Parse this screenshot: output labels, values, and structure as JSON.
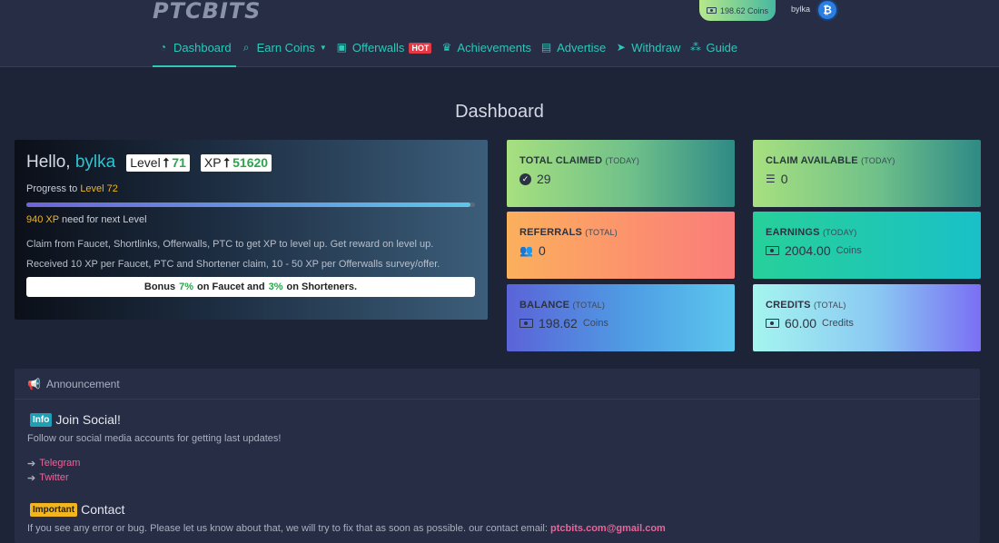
{
  "header": {
    "logo": "PTCBITS",
    "balance_pill": "198.62 Coins",
    "username": "bylka",
    "avatar_icon": "bitcoin-icon"
  },
  "nav": [
    {
      "label": "Dashboard",
      "icon": "dashboard-icon",
      "active": true
    },
    {
      "label": "Earn Coins",
      "icon": "search-dollar-icon",
      "dropdown": true
    },
    {
      "label": "Offerwalls",
      "icon": "gift-icon",
      "badge": "HOT"
    },
    {
      "label": "Achievements",
      "icon": "trophy-icon"
    },
    {
      "label": "Advertise",
      "icon": "ad-icon"
    },
    {
      "label": "Withdraw",
      "icon": "paper-plane-icon"
    },
    {
      "label": "Guide",
      "icon": "sitemap-icon"
    }
  ],
  "page_title": "Dashboard",
  "hello": {
    "greeting": "Hello,",
    "username": "bylka",
    "level_label": "Level",
    "level_value": "71",
    "xp_label": "XP",
    "xp_value": "51620",
    "progress_prefix": "Progress to",
    "progress_target": "Level 72",
    "progress_fraction": 0.99,
    "xp_needed": "940 XP",
    "xp_needed_suffix": "need for next Level",
    "desc1": "Claim from Faucet, Shortlinks, Offerwalls, PTC to get XP to level up. Get reward on level up.",
    "desc2": "Received 10 XP per Faucet, PTC and Shortener claim, 10 - 50 XP per Offerwalls survey/offer.",
    "bonus_prefix": "Bonus",
    "bonus_faucet_pct": "7%",
    "bonus_mid": "on Faucet and",
    "bonus_short_pct": "3%",
    "bonus_suffix": "on Shorteners."
  },
  "stats": {
    "total_claimed": {
      "title": "TOTAL CLAIMED",
      "sub": "(TODAY)",
      "value": "29",
      "icon": "check-circle-icon"
    },
    "claim_available": {
      "title": "CLAIM AVAILABLE",
      "sub": "(TODAY)",
      "value": "0",
      "icon": "tasks-icon"
    },
    "referrals": {
      "title": "REFERRALS",
      "sub": "(TOTAL)",
      "value": "0",
      "icon": "users-icon"
    },
    "earnings": {
      "title": "EARNINGS",
      "sub": "(TODAY)",
      "value": "2004.00",
      "unit": "Coins",
      "icon": "money-bill-icon"
    },
    "balance": {
      "title": "BALANCE",
      "sub": "(TOTAL)",
      "value": "198.62",
      "unit": "Coins",
      "icon": "money-bill-icon"
    },
    "credits": {
      "title": "CREDITS",
      "sub": "(TOTAL)",
      "value": "60.00",
      "unit": "Credits",
      "icon": "money-bill-icon"
    }
  },
  "announcement": {
    "header": "Announcement",
    "social_badge": "Info",
    "social_title": "Join Social!",
    "social_text": "Follow our social media accounts for getting last updates!",
    "links": [
      "Telegram",
      "Twitter"
    ],
    "contact_badge": "Important",
    "contact_title": "Contact",
    "contact_text": "If you see any error or bug. Please let us know about that, we will try to fix that as soon as possible. our contact email:",
    "contact_email": "ptcbits.com@gmail.com"
  }
}
